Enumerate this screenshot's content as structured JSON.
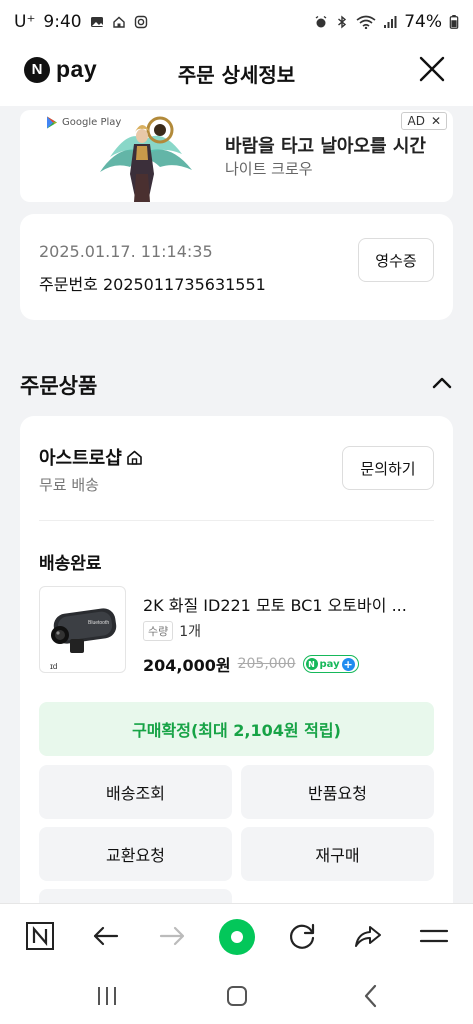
{
  "status_bar": {
    "carrier": "U⁺",
    "time": "9:40",
    "battery": "74%"
  },
  "header": {
    "logo_text": "pay",
    "logo_letter": "N",
    "title": "주문 상세정보"
  },
  "ad": {
    "store_label": "Google Play",
    "title": "바람을 타고 날아오를 시간",
    "subtitle": "나이트 크로우",
    "badge": "AD",
    "badge_close": "✕"
  },
  "order": {
    "datetime": "2025.01.17. 11:14:35",
    "order_number": "주문번호 2025011735631551",
    "receipt_label": "영수증"
  },
  "section": {
    "title": "주문상품"
  },
  "product_card": {
    "shop_name": "아스트로샵",
    "shipping": "무료 배송",
    "inquiry_label": "문의하기",
    "delivery_status": "배송완료",
    "product_name": "2K 화질 ID221 모토 BC1 오토바이 ...",
    "qty_tag": "수량",
    "qty_value": "1개",
    "price": "204,000원",
    "original_price": "205,000",
    "npay_badge_letter": "N",
    "npay_badge_text": "pay",
    "npay_badge_plus": "+",
    "confirm_label": "구매확정(최대 2,104원 적립)",
    "actions": [
      "배송조회",
      "반품요청",
      "교환요청",
      "재구매"
    ]
  },
  "colors": {
    "accent_green": "#17a346",
    "confirm_bg": "#e8f8ec",
    "npay_blue": "#1e8cf0"
  }
}
